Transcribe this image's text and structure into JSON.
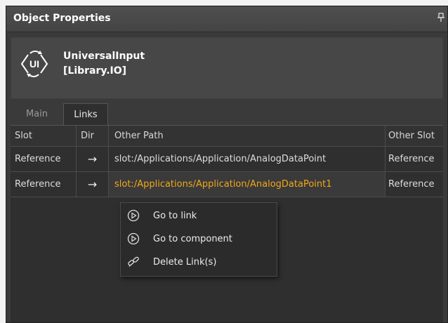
{
  "panel": {
    "title": "Object Properties",
    "pin_glyph": "📌"
  },
  "component": {
    "icon": "ui-icon",
    "icon_text": "UI",
    "name": "UniversalInput",
    "library": "[Library.IO]"
  },
  "tabs": [
    {
      "label": "Main",
      "active": false
    },
    {
      "label": "Links",
      "active": true
    }
  ],
  "links_table": {
    "columns": [
      "Slot",
      "Dir",
      "Other Path",
      "Other Slot"
    ],
    "rows": [
      {
        "slot": "Reference",
        "dir": "→",
        "other_path": "slot:/Applications/Application/AnalogDataPoint",
        "other_slot": "Reference",
        "selected": false
      },
      {
        "slot": "Reference",
        "dir": "→",
        "other_path": "slot:/Applications/Application/AnalogDataPoint1",
        "other_slot": "Reference",
        "selected": true
      }
    ]
  },
  "context_menu": {
    "items": [
      {
        "label": "Go to link",
        "icon": "play-circle-icon"
      },
      {
        "label": "Go to component",
        "icon": "play-circle-icon"
      },
      {
        "label": "Delete Link(s)",
        "icon": "broken-link-icon"
      }
    ]
  },
  "colors": {
    "panel_bg": "#3a3a3a",
    "grid_bg": "#2f2f2f",
    "selected_path_text": "#f0a818"
  }
}
